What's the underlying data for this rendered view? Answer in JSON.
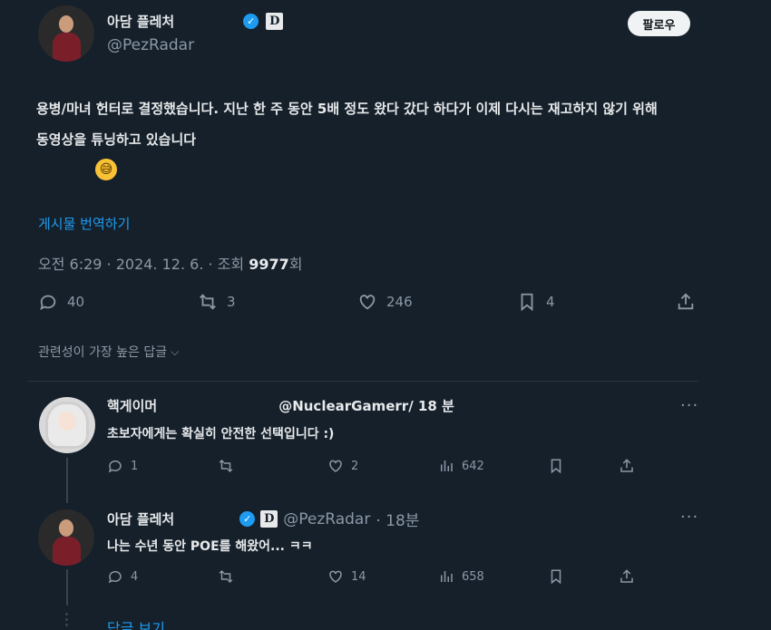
{
  "post": {
    "author_name": "아담 플레처",
    "author_handle": "@PezRadar",
    "follow_label": "팔로우",
    "text_line1": "용병/마녀 헌터로 결정했습니다. 지난 한 주 동안 5배 정도 왔다 갔다 하다가 이제 다시는 재고하지 않기 위해",
    "text_line2": "동영상을 튜닝하고 있습니다",
    "translate_label": "게시물 번역하기",
    "meta_time": "오전 6:29 · 2024. 12. 6. · 조회 ",
    "meta_views": "9977",
    "meta_views_suffix": "회",
    "replies": "40",
    "reposts": "3",
    "likes": "246",
    "bookmarks": "4"
  },
  "sort_label": "관련성이 가장 높은 답글",
  "replies": [
    {
      "name": "핵게이머",
      "handle": "@NuclearGamerr",
      "time": "/ 18 분",
      "text": "초보자에게는 확실히 안전한 선택입니다 :)",
      "replies": "1",
      "reposts": "",
      "likes": "2",
      "views": "642"
    },
    {
      "name": "아담 플레처",
      "handle": "@PezRadar",
      "time": "· 18분",
      "text": "나는 수년 동안 POE를 해왔어... ㅋㅋ",
      "replies": "4",
      "reposts": "",
      "likes": "14",
      "views": "658"
    }
  ],
  "more_replies_label": "답글 보기",
  "colors": {
    "background": "#15202b",
    "accent": "#1d9bf0",
    "muted": "#8b98a5"
  }
}
